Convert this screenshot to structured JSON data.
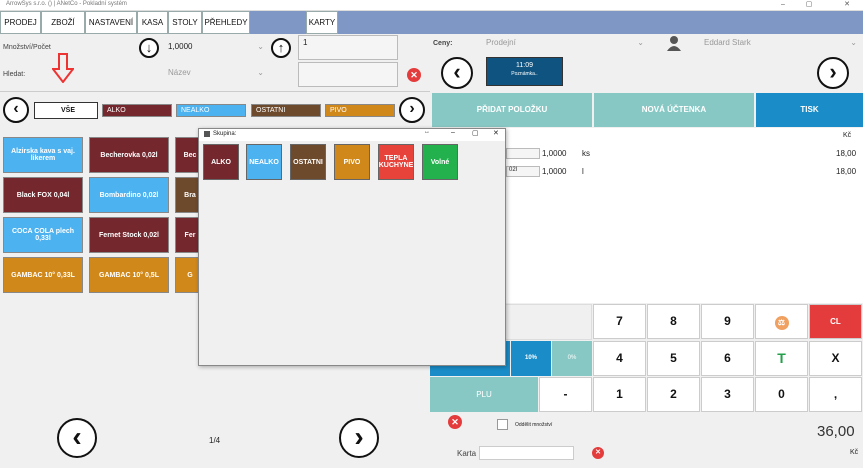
{
  "window": {
    "title": "ArrowSys s.r.o. () | ANetCo - Pokladní systém"
  },
  "menu": [
    "PRODEJ",
    "ZBOŽÍ",
    "NASTAVENÍ",
    "KASA",
    "STOLY",
    "PŘEHLEDY",
    "KARTY"
  ],
  "qty": {
    "label": "Množství/Počet",
    "value": "1,0000",
    "input": "1"
  },
  "search": {
    "label": "Hledat:",
    "field": "Název"
  },
  "prices": {
    "label": "Ceny:",
    "value": "Prodejní"
  },
  "user": {
    "name": "Eddard  Stark"
  },
  "note": {
    "time": "11:09",
    "text": "Poznámka.."
  },
  "categories": [
    {
      "label": "VŠE",
      "color": "#ffffff"
    },
    {
      "label": "ALKO",
      "color": "#74282e"
    },
    {
      "label": "NEALKO",
      "color": "#4db2f0"
    },
    {
      "label": "OSTATNI",
      "color": "#6e4a2c"
    },
    {
      "label": "PIVO",
      "color": "#d1881a"
    }
  ],
  "products": [
    {
      "name": "Alzirska kava s vaj. likerem",
      "color": "#4db2f0"
    },
    {
      "name": "Becherovka 0,02l",
      "color": "#74282e"
    },
    {
      "name": "Bec",
      "color": "#74282e"
    },
    {
      "name": "Black FOX 0,04l",
      "color": "#74282e"
    },
    {
      "name": "Bombardino 0,02l",
      "color": "#4db2f0"
    },
    {
      "name": "Bra",
      "color": "#6e4a2c"
    },
    {
      "name": "COCA COLA plech 0,33l",
      "color": "#4db2f0"
    },
    {
      "name": "Fernet Stock 0,02l",
      "color": "#74282e"
    },
    {
      "name": "Fer",
      "color": "#74282e"
    },
    {
      "name": "GAMBAC 10° 0,33L",
      "color": "#d1881a"
    },
    {
      "name": "GAMBAC 10° 0,5L",
      "color": "#d1881a"
    },
    {
      "name": "G",
      "color": "#d1881a"
    }
  ],
  "paging": {
    "page": "1/4"
  },
  "actions": {
    "add": "PŘIDAT POLOŽKU",
    "new": "NOVÁ ÚČTENKA",
    "print": "TISK"
  },
  "order": {
    "currency": "Kč",
    "rows": [
      {
        "code": "",
        "qty": "1,0000",
        "unit": "ks",
        "price": "18,00"
      },
      {
        "code": "02l",
        "qty": "1,0000",
        "unit": "l",
        "price": "18,00"
      }
    ]
  },
  "discounts": {
    "d1": "10%",
    "d2": "0%"
  },
  "plu": "PLU",
  "keys": {
    "k7": "7",
    "k8": "8",
    "k9": "9",
    "cl": "CL",
    "k4": "4",
    "k5": "5",
    "k6": "6",
    "t": "T",
    "x": "X",
    "minus": "-",
    "k1": "1",
    "k2": "2",
    "k3": "3",
    "k0": "0",
    "comma": ","
  },
  "split": {
    "label": "Oddělit množství"
  },
  "total": {
    "value": "36,00",
    "currency": "Kč"
  },
  "card": {
    "label": "Karta"
  },
  "dialog": {
    "title": "Skupina:",
    "groups": [
      {
        "label": "ALKO",
        "color": "#74282e"
      },
      {
        "label": "NEALKO",
        "color": "#4db2f0"
      },
      {
        "label": "OSTATNI",
        "color": "#6e4a2c"
      },
      {
        "label": "PIVO",
        "color": "#d1881a"
      },
      {
        "label": "TEPLA KUCHYNE",
        "color": "#e8433a"
      },
      {
        "label": "Volné",
        "color": "#22b14c"
      }
    ]
  }
}
